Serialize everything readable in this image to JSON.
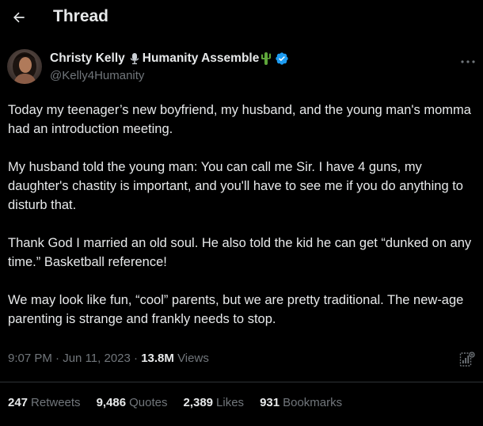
{
  "header": {
    "title": "Thread"
  },
  "tweet": {
    "author": {
      "display_name": "Christy Kelly",
      "display_name_suffix": "Humanity Assemble",
      "handle": "@Kelly4Humanity",
      "verified_color": "#1d9bf0"
    },
    "paragraphs": [
      "Today my teenager’s new boyfriend, my husband, and the young man's momma had an introduction meeting.",
      "My husband told the young man: You can call me Sir. I have 4 guns, my daughter's chastity is important, and you'll have to see me if you do anything to disturb that.",
      "Thank God I married an old soul.  He also told the kid he can get “dunked on any time.”  Basketball reference!",
      "We may look like fun, “cool” parents, but we are pretty traditional.  The new-age parenting is strange and frankly needs to stop."
    ],
    "time": "9:07 PM",
    "separator": "·",
    "date": "Jun 11, 2023",
    "views_count": "13.8M",
    "views_label": "Views",
    "stats": {
      "retweets": {
        "count": "247",
        "label": "Retweets"
      },
      "quotes": {
        "count": "9,486",
        "label": "Quotes"
      },
      "likes": {
        "count": "2,389",
        "label": "Likes"
      },
      "bookmarks": {
        "count": "931",
        "label": "Bookmarks"
      }
    }
  },
  "icons": {
    "back": "arrow-left-icon",
    "mic": "microphone-icon",
    "cactus": "cactus-icon",
    "verified": "verified-badge-icon",
    "more": "more-dots-icon",
    "analytics": "analytics-icon"
  },
  "colors": {
    "background": "#000000",
    "text": "#e7e9ea",
    "muted": "#71767b",
    "divider": "#2f3336",
    "accent": "#1d9bf0"
  }
}
